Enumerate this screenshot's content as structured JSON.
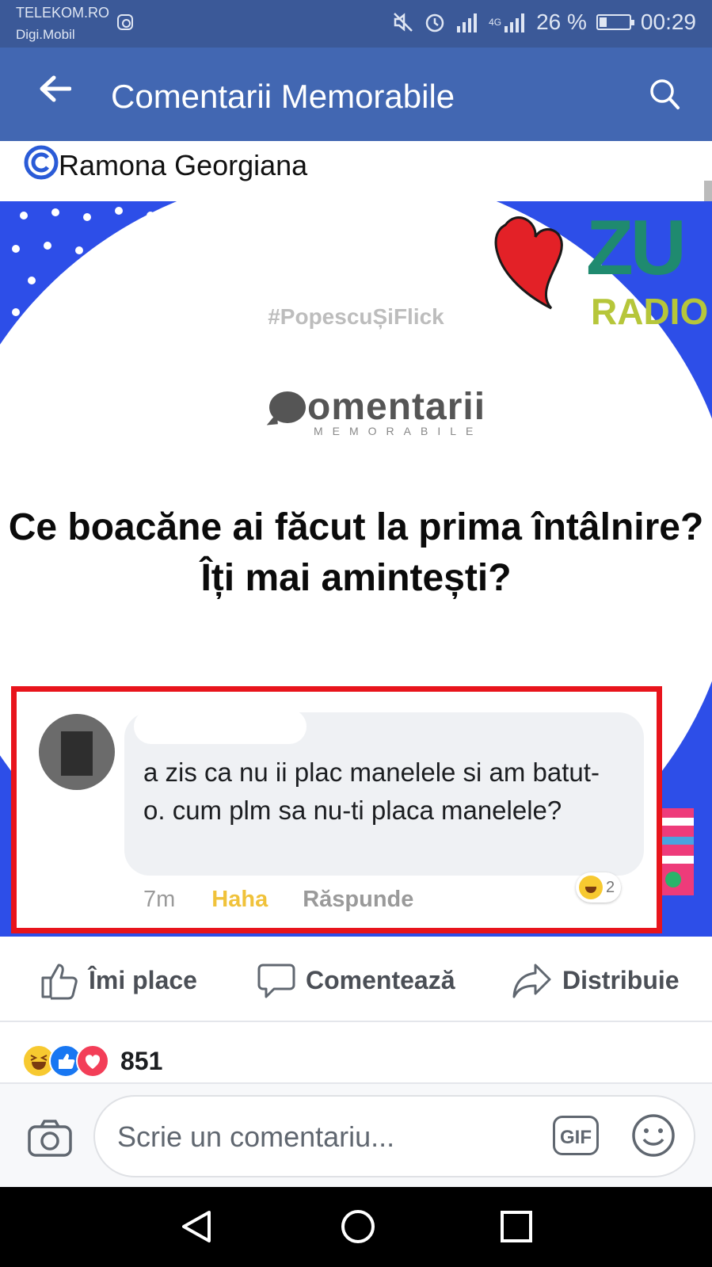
{
  "status_bar": {
    "carrier": "TELEKOM.RO",
    "carrier_secondary": "Digi.Mobil",
    "battery_text": "26 %",
    "battery_level": 0.26,
    "network": "4G",
    "time": "00:29"
  },
  "app_bar": {
    "title": "Comentarii Memorabile",
    "icons": [
      "back-arrow-icon",
      "search-icon"
    ]
  },
  "post": {
    "credit": "Ramona Georgiana",
    "credit_icon": "copyright-icon",
    "image": {
      "hashtag": "#PopescuȘiFlick",
      "brand_main": "omentarii",
      "brand_sub": "MEMORABILE",
      "radio_brand_top": "ZU",
      "radio_brand_bottom": "RADIO",
      "question_line1": "Ce boacăne ai făcut la prima întâlnire?",
      "question_line2": "Îți mai amintești?",
      "comment": {
        "text": "a zis ca nu ii plac manelele si am batut-o. cum plm sa nu-ti placa manelele?",
        "time": "7m",
        "reaction_label": "Haha",
        "reply_label": "Răspunde",
        "reaction_count": "2"
      },
      "colors": {
        "blue": "#2d4ee8",
        "frame_red": "#e8141c",
        "zu_green": "#1f8a6f",
        "radio_yellow": "#b6c63a"
      }
    },
    "actions": {
      "like": "Îmi place",
      "comment": "Comentează",
      "share": "Distribuie"
    },
    "reactions_count": "851"
  },
  "composer": {
    "placeholder": "Scrie un comentariu...",
    "gif_label": "GIF"
  },
  "colors": {
    "fb_blue": "#4267b2",
    "status_blue": "#3b5998"
  }
}
